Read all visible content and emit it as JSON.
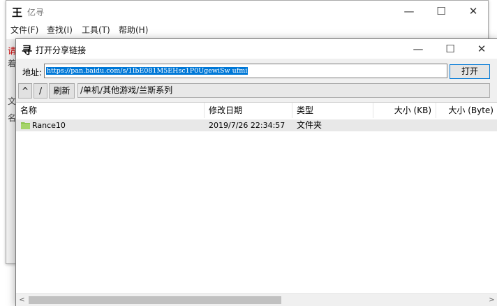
{
  "background_window": {
    "icon": "王",
    "title": "亿寻",
    "menu": [
      "文件(F)",
      "查找(I)",
      "工具(T)",
      "帮助(H)"
    ],
    "side_clipped_text": [
      "请",
      "着",
      "文",
      "名"
    ]
  },
  "dialog": {
    "icon": "寻",
    "title": "打开分享链接",
    "address_label": "地址:",
    "address_value": "https://pan.baidu.com/s/1IbE081M5EHsc1P0UgewiSw ufmi",
    "open_label": "打开",
    "up_label": "^",
    "root_label": "/",
    "refresh_label": "刷新",
    "path": "/单机/其他游戏/兰斯系列",
    "columns": [
      "名称",
      "修改日期",
      "类型",
      "大小 (KB)",
      "大小 (Byte)"
    ],
    "rows": [
      {
        "name": "Rance10",
        "modified": "2019/7/26 22:34:57",
        "type": "文件夹",
        "size_kb": "",
        "size_byte": ""
      }
    ]
  },
  "window_controls": {
    "minimize": "—",
    "maximize": "☐",
    "close": "✕"
  },
  "colors": {
    "selection": "#0078d7",
    "folder": "#8bc34a",
    "row_highlight": "#e8e8e8"
  }
}
